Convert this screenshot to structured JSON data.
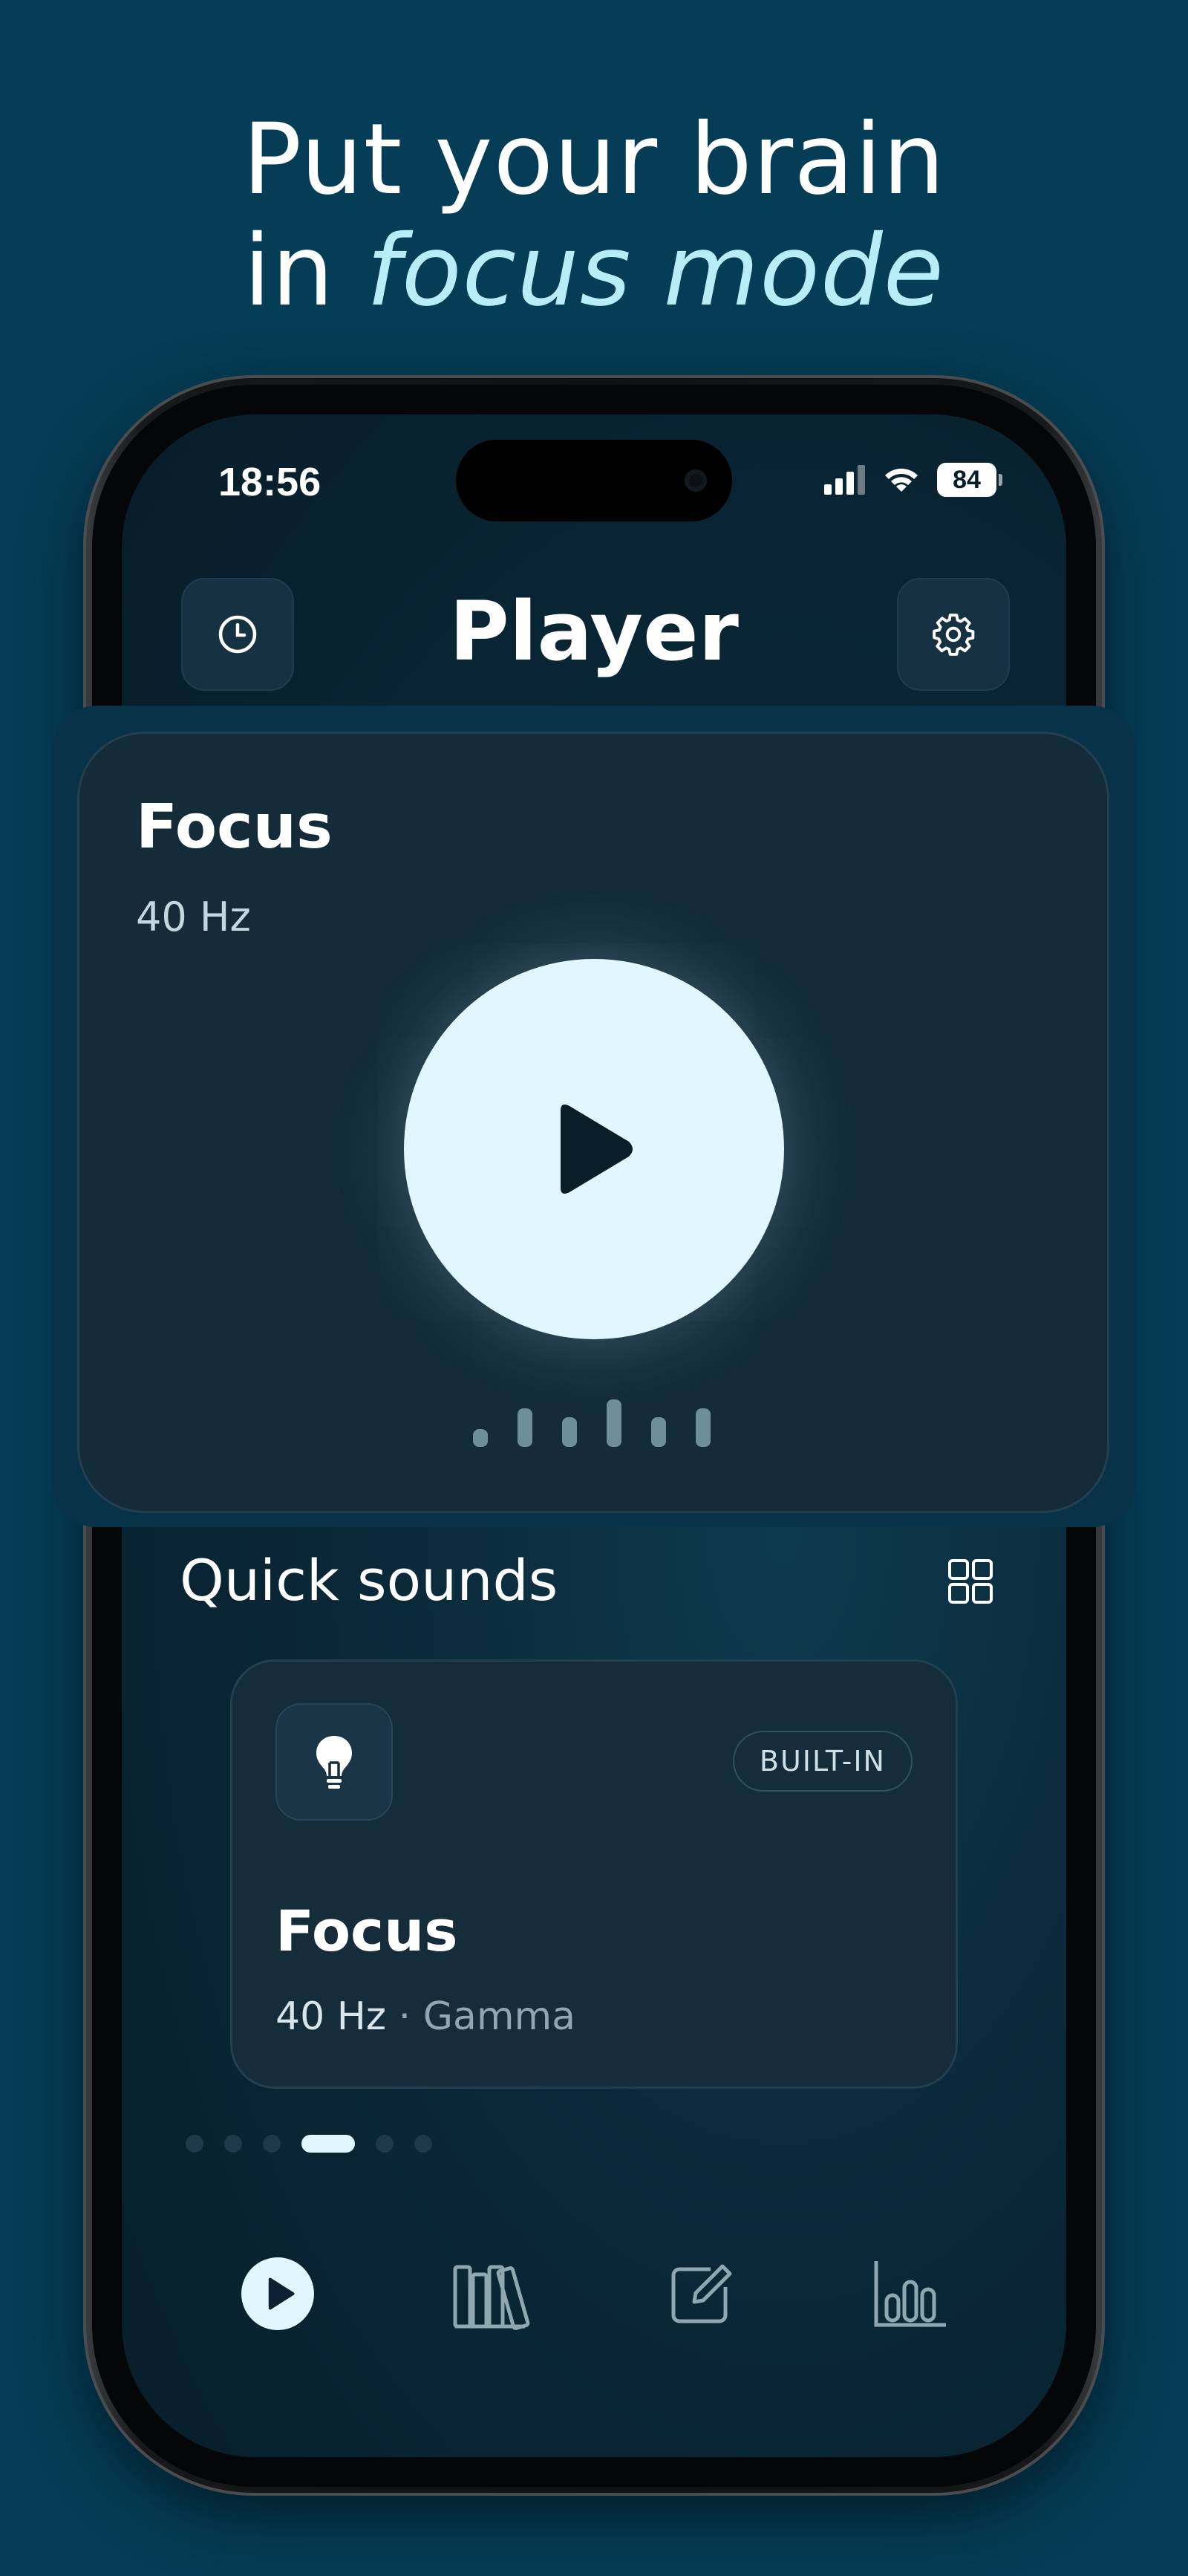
{
  "headline": {
    "line1": "Put your brain",
    "line2_prefix": "in ",
    "line2_accent": "focus mode"
  },
  "status_bar": {
    "time": "18:56",
    "battery": "84",
    "icons": [
      "signal-icon",
      "wifi-icon",
      "battery-icon"
    ]
  },
  "header": {
    "title": "Player",
    "left_icon": "history-icon",
    "right_icon": "gear-icon"
  },
  "player": {
    "title": "Focus",
    "subtitle": "40 Hz",
    "control_icon": "play-icon"
  },
  "quick_sounds": {
    "title": "Quick sounds",
    "layout_icon": "grid-icon",
    "card": {
      "icon": "lightbulb-icon",
      "badge": "BUILT-IN",
      "title": "Focus",
      "frequency": "40 Hz",
      "separator": "·",
      "band": "Gamma"
    },
    "page_count": 6,
    "active_page": 3
  },
  "tabbar": {
    "items": [
      "player-tab",
      "library-tab",
      "journal-tab",
      "stats-tab"
    ],
    "active": 0
  },
  "colors": {
    "background": "#053d56",
    "accent": "#b8ecf6",
    "play_fill": "#e1f7ff",
    "card": "#142c3a"
  }
}
